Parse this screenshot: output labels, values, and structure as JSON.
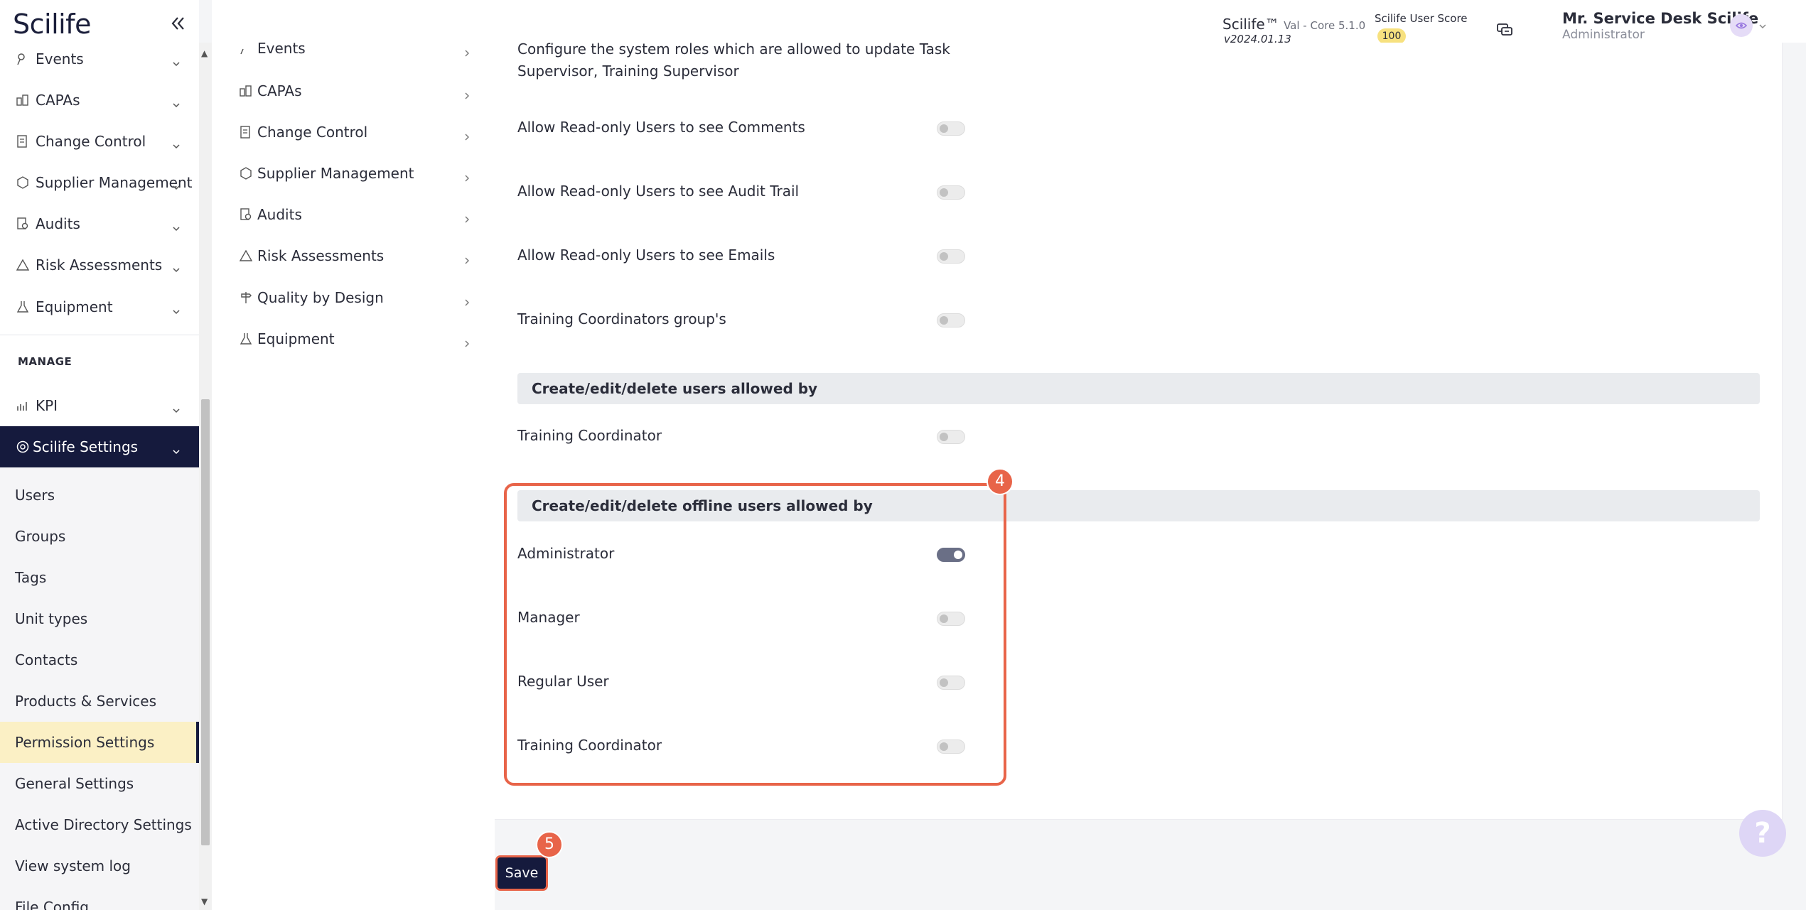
{
  "app": {
    "logo": "Scilife"
  },
  "sidebar": {
    "items": [
      {
        "label": "Events",
        "icon": "pin-icon"
      },
      {
        "label": "CAPAs",
        "icon": "people-icon"
      },
      {
        "label": "Change Control",
        "icon": "document-icon"
      },
      {
        "label": "Supplier Management",
        "icon": "box-icon"
      },
      {
        "label": "Audits",
        "icon": "audit-icon"
      },
      {
        "label": "Risk Assessments",
        "icon": "warning-icon"
      },
      {
        "label": "Equipment",
        "icon": "flask-icon"
      }
    ],
    "manage_label": "MANAGE",
    "kpi_label": "KPI",
    "active_label": "Scilife Settings",
    "subitems": [
      {
        "label": "Users"
      },
      {
        "label": "Groups"
      },
      {
        "label": "Tags"
      },
      {
        "label": "Unit types"
      },
      {
        "label": "Contacts"
      },
      {
        "label": "Products & Services"
      },
      {
        "label": "Permission Settings"
      },
      {
        "label": "General Settings"
      },
      {
        "label": "Active Directory Settings"
      },
      {
        "label": "View system log"
      },
      {
        "label": "File Config"
      }
    ]
  },
  "topbar": {
    "product": "Scilife™",
    "product_version": "Val - Core 5.1.0",
    "product_date": "v2024.01.13",
    "score_label": "Scilife User Score",
    "score_value": "100",
    "user_name": "Mr. Service Desk Scilife",
    "user_role": "Administrator"
  },
  "secnav": {
    "items": [
      {
        "label": "Events"
      },
      {
        "label": "CAPAs"
      },
      {
        "label": "Change Control"
      },
      {
        "label": "Supplier Management"
      },
      {
        "label": "Audits"
      },
      {
        "label": "Risk Assessments"
      },
      {
        "label": "Quality by Design"
      },
      {
        "label": "Equipment"
      }
    ]
  },
  "main": {
    "intro": "Configure the system roles which are allowed to update Task Supervisor, Training Supervisor",
    "rows_top": [
      {
        "label": "Allow Read-only Users to see Comments",
        "on": false
      },
      {
        "label": "Allow Read-only Users to see Audit Trail",
        "on": false
      },
      {
        "label": "Allow Read-only Users to see Emails",
        "on": false
      },
      {
        "label": "Training Coordinators group's",
        "on": false
      }
    ],
    "section1": {
      "title": "Create/edit/delete users allowed by",
      "rows": [
        {
          "label": "Training Coordinator",
          "on": false
        }
      ]
    },
    "section2": {
      "title": "Create/edit/delete offline users allowed by",
      "rows": [
        {
          "label": "Administrator",
          "on": true
        },
        {
          "label": "Manager",
          "on": false
        },
        {
          "label": "Regular User",
          "on": false
        },
        {
          "label": "Training Coordinator",
          "on": false
        }
      ]
    },
    "save_label": "Save"
  },
  "annotations": {
    "step4": "4",
    "step5": "5"
  },
  "help": {
    "label": "?"
  },
  "colors": {
    "navy": "#151a3d",
    "accent": "#e86449",
    "highlight": "#fbf0c5"
  }
}
